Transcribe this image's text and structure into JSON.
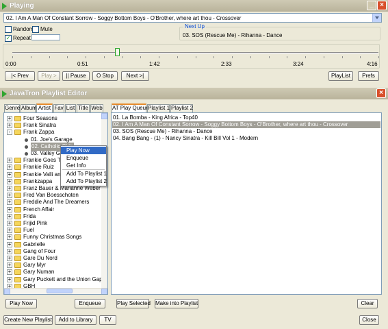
{
  "player": {
    "title": "Playing",
    "now_playing": "02. I Am A Man Of Constant Sorrow - Soggy Bottom Boys - O'Brother, where art thou - Crossover",
    "random_label": "Random",
    "mute_label": "Mute",
    "repeat_label": "Repeat",
    "repeat_checked": "✓",
    "next_up_title": "Next Up",
    "next_up_track": "03. SOS (Rescue Me) - Rihanna - Dance",
    "position_fraction": 0.6,
    "time_labels": [
      "0:00",
      "0:51",
      "1:42",
      "2:33",
      "3:24",
      "4:16"
    ],
    "buttons": {
      "prev": "|< Prev",
      "play": "Play >",
      "pause": "|| Pause",
      "stop": "O Stop",
      "next": "Next >|",
      "playlist": "PlayList",
      "prefs": "Prefs"
    }
  },
  "editor": {
    "title": "JavaTron Playlist Editor",
    "left_tabs": [
      "Genre",
      "Album",
      "Artist",
      "Fav",
      "List",
      "Title",
      "Web"
    ],
    "active_left_tab": "Artist",
    "tree": [
      {
        "label": "Four Seasons",
        "type": "folder",
        "state": "+"
      },
      {
        "label": "Frank Sinatra",
        "type": "folder",
        "state": "+"
      },
      {
        "label": "Frank Zappa",
        "type": "folder",
        "state": "-"
      },
      {
        "label": "01. Joe's Garage",
        "type": "track"
      },
      {
        "label": "02. Catholic Girls",
        "type": "track",
        "selected": true
      },
      {
        "label": "03. Valley Girl",
        "type": "track"
      },
      {
        "label": "Frankie Goes To Hollywood",
        "type": "folder",
        "state": "+"
      },
      {
        "label": "Frankie Ruiz",
        "type": "folder",
        "state": "+"
      },
      {
        "label": "Frankie Valli and the Four Seasons",
        "type": "folder",
        "state": "+"
      },
      {
        "label": "Frankzappa",
        "type": "folder",
        "state": "+"
      },
      {
        "label": "Franz Bauer & Marianne Weber",
        "type": "folder",
        "state": "+"
      },
      {
        "label": "Fred Van Boesschoten",
        "type": "folder",
        "state": "+"
      },
      {
        "label": "Freddie And The Dreamers",
        "type": "folder",
        "state": "+"
      },
      {
        "label": "French Affair",
        "type": "folder",
        "state": "+"
      },
      {
        "label": "Frida",
        "type": "folder",
        "state": "+"
      },
      {
        "label": "Frijid Pink",
        "type": "folder",
        "state": "+"
      },
      {
        "label": "Fuel",
        "type": "folder",
        "state": "+"
      },
      {
        "label": "Funny Christmas Songs",
        "type": "folder",
        "state": "+"
      },
      {
        "label": "Gabrielle",
        "type": "folder",
        "state": "+"
      },
      {
        "label": "Gang of Four",
        "type": "folder",
        "state": "+"
      },
      {
        "label": "Gare Du Nord",
        "type": "folder",
        "state": "+"
      },
      {
        "label": "Gary Myr",
        "type": "folder",
        "state": "+"
      },
      {
        "label": "Gary Numan",
        "type": "folder",
        "state": "+"
      },
      {
        "label": "Gary Puckett and the Union Gap",
        "type": "folder",
        "state": "+"
      },
      {
        "label": "GBH",
        "type": "folder",
        "state": "+"
      }
    ],
    "context_menu": [
      "Play Now",
      "Enqueue",
      "Get Info",
      "Add To Playlist 1",
      "Add To Playlist 2"
    ],
    "right_tabs": [
      "AT Play Queue",
      "Playlist 1",
      "Playlist 2"
    ],
    "active_right_tab": "AT Play Queue",
    "queue": [
      {
        "text": "01. La Bomba - King Africa - Top40"
      },
      {
        "text": "02. I Am A Man Of Constant Sorrow - Soggy Bottom Boys - O'Brother, where art thou - Crossover",
        "selected": true
      },
      {
        "text": "03. SOS (Rescue Me) - Rihanna - Dance"
      },
      {
        "text": "04. Bang Bang - (1) - Nancy Sinatra - Kill Bill Vol 1 - Modern"
      }
    ],
    "buttons": {
      "play_now": "Play Now",
      "enqueue": "Enqueue",
      "play_selected": "Play Selected",
      "make_playlist": "Make into Playlist",
      "clear": "Clear",
      "create_playlist": "Create New Playlist",
      "add_library": "Add to Library",
      "tv": "TV",
      "close": "Close"
    }
  },
  "colors": {
    "accent_green": "#21a121",
    "selection_gray": "#a09e96",
    "menu_highlight": "#316ac5",
    "next_up_title": "#0046d5"
  }
}
